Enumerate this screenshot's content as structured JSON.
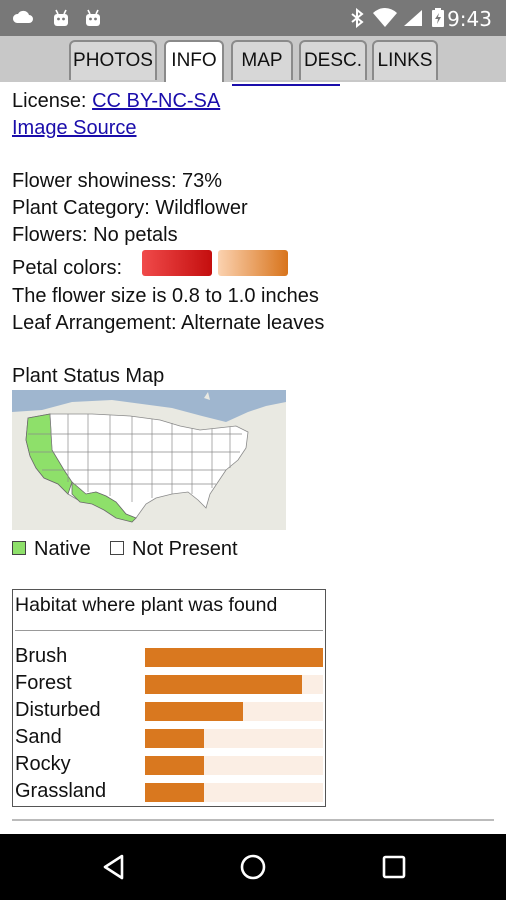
{
  "status_bar": {
    "time": "9:43",
    "left_icons": [
      "cloud-icon",
      "android-icon",
      "android-icon"
    ],
    "right_icons": [
      "bluetooth-icon",
      "wifi-icon",
      "signal-icon",
      "battery-icon"
    ]
  },
  "tabs": [
    {
      "label": "PHOTOS",
      "active": false
    },
    {
      "label": "INFO",
      "active": true
    },
    {
      "label": "MAP",
      "active": false
    },
    {
      "label": "DESC.",
      "active": false
    },
    {
      "label": "LINKS",
      "active": false
    }
  ],
  "info": {
    "license_label": "License: ",
    "license_link": "CC BY-NC-SA",
    "image_source_link": "Image Source",
    "showiness": "Flower showiness: 73%",
    "category": "Plant Category: Wildflower",
    "flowers": "Flowers: No petals",
    "petal_colors_label": "Petal colors:",
    "petal_colors": [
      {
        "from": "#f04a4a",
        "to": "#c40e0e"
      },
      {
        "from": "#fbd2b0",
        "to": "#d8741c"
      }
    ],
    "flower_size": "The flower size is 0.8 to 1.0 inches",
    "leaf_arrangement": "Leaf Arrangement: Alternate leaves"
  },
  "status_map": {
    "title": "Plant Status Map",
    "legend": [
      {
        "label": "Native",
        "color": "#8ee06a"
      },
      {
        "label": "Not Present",
        "color": "#ffffff"
      }
    ]
  },
  "habitat": {
    "title": "Habitat where plant was found",
    "rows": [
      {
        "label": "Brush",
        "value": 1.0
      },
      {
        "label": "Forest",
        "value": 0.88
      },
      {
        "label": "Disturbed",
        "value": 0.55
      },
      {
        "label": "Sand",
        "value": 0.33
      },
      {
        "label": "Rocky",
        "value": 0.33
      },
      {
        "label": "Grassland",
        "value": 0.33
      }
    ],
    "bar_color": "#d9781f",
    "track_color": "#fbeee4"
  },
  "nav": {
    "icons": [
      "back-icon",
      "home-icon",
      "recents-icon"
    ]
  }
}
